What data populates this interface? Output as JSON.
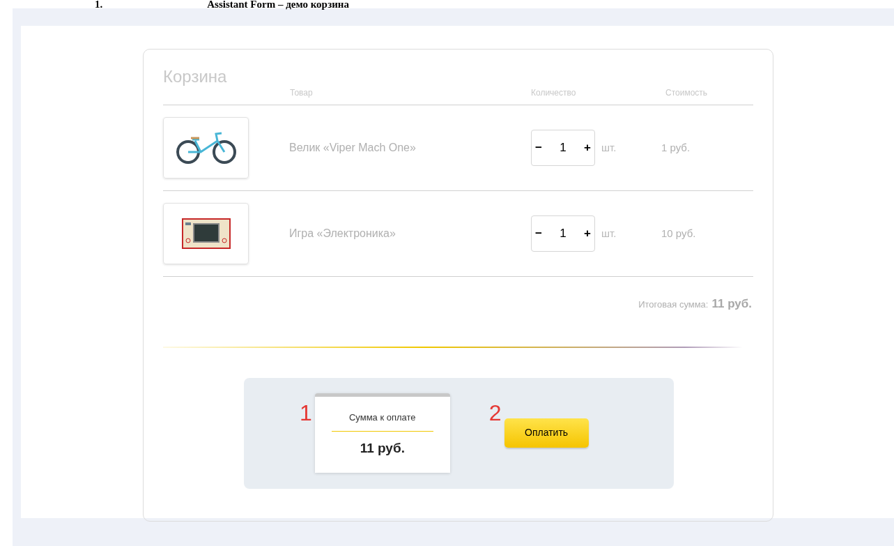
{
  "heading": {
    "number": "1.",
    "title": "Assistant Form – демо корзина"
  },
  "cart": {
    "title": "Корзина",
    "columns": [
      "Товар",
      "Количество",
      "Стоимость"
    ],
    "rows": [
      {
        "kind": "bicycle",
        "name": "Велик «Viper Mach One»",
        "minus": "−",
        "qty": "1",
        "plus": "+",
        "unit": "шт.",
        "price": "1 руб."
      },
      {
        "kind": "game",
        "name": "Игра «Электроника»",
        "minus": "−",
        "qty": "1",
        "plus": "+",
        "unit": "шт.",
        "price": "10 руб."
      }
    ],
    "total_label": "Итоговая сумма:",
    "total_value": "11 руб."
  },
  "payment": {
    "marker_1": "1",
    "receipt_label": "Сумма к оплате",
    "receipt_amount": "11 руб.",
    "marker_2": "2",
    "pay_button": "Оплатить"
  }
}
